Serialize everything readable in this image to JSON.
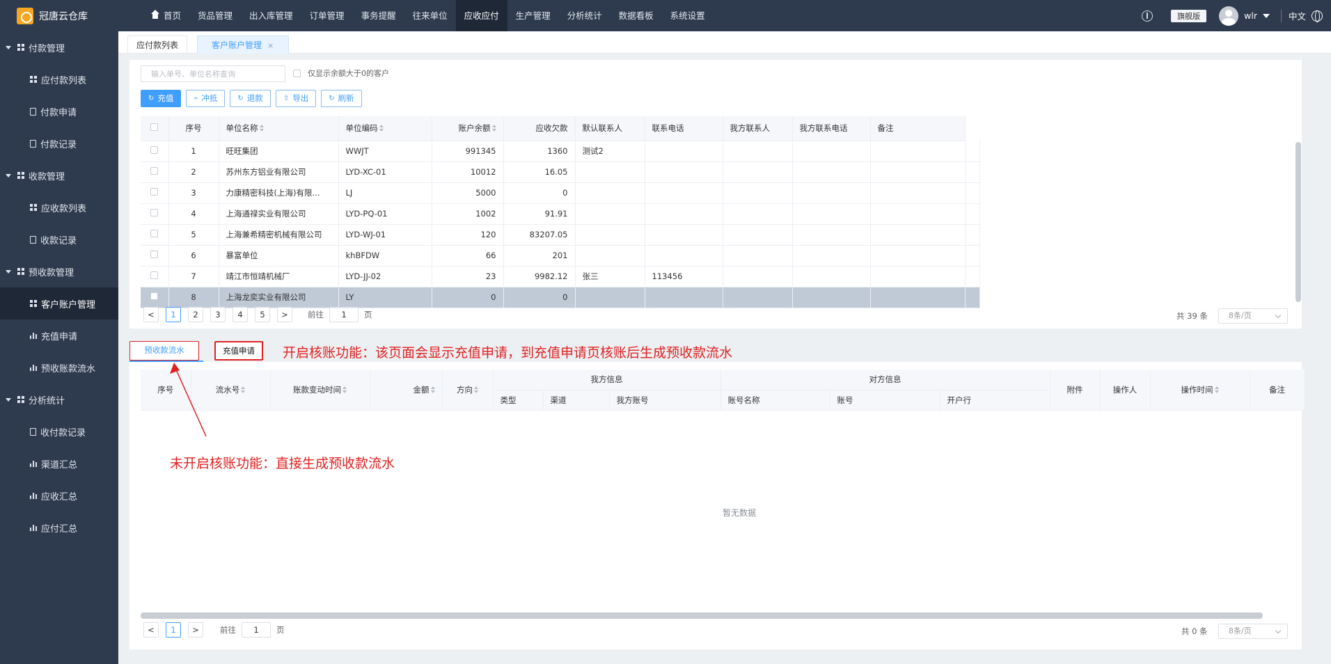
{
  "app": {
    "title": "冠唐云仓库"
  },
  "nav": [
    {
      "label": "首页",
      "icon": "home-icon"
    },
    {
      "label": "货品管理"
    },
    {
      "label": "出入库管理"
    },
    {
      "label": "订单管理"
    },
    {
      "label": "事务提醒"
    },
    {
      "label": "往来单位"
    },
    {
      "label": "应收应付",
      "active": true
    },
    {
      "label": "生产管理"
    },
    {
      "label": "分析统计"
    },
    {
      "label": "数据看板"
    },
    {
      "label": "系统设置"
    }
  ],
  "header": {
    "edition": "旗舰版",
    "user": "wlr",
    "language": "中文"
  },
  "sidebar": {
    "groups": [
      {
        "label": "付款管理",
        "items": [
          {
            "label": "应付款列表",
            "icon": "grid-icon"
          },
          {
            "label": "付款申请",
            "icon": "doc-icon"
          },
          {
            "label": "付款记录",
            "icon": "doc-icon"
          }
        ]
      },
      {
        "label": "收款管理",
        "items": [
          {
            "label": "应收款列表",
            "icon": "grid-icon"
          },
          {
            "label": "收款记录",
            "icon": "doc-icon"
          }
        ]
      },
      {
        "label": "预收款管理",
        "items": [
          {
            "label": "客户账户管理",
            "icon": "grid-icon",
            "active": true
          },
          {
            "label": "充值申请",
            "icon": "bar-chart-icon"
          },
          {
            "label": "预收账款流水",
            "icon": "bar-chart-icon"
          }
        ]
      },
      {
        "label": "分析统计",
        "items": [
          {
            "label": "收付款记录",
            "icon": "doc-icon"
          },
          {
            "label": "渠道汇总",
            "icon": "bar-chart-icon"
          },
          {
            "label": "应收汇总",
            "icon": "bar-chart-icon"
          },
          {
            "label": "应付汇总",
            "icon": "bar-chart-icon"
          }
        ]
      }
    ]
  },
  "tabs": [
    {
      "label": "应付款列表"
    },
    {
      "label": "客户账户管理",
      "active": true,
      "close": "×"
    }
  ],
  "search": {
    "placeholder": "输入单号、单位名称查询",
    "only_positive_label": "仅显示余额大于0的客户"
  },
  "toolbar": [
    {
      "label": "充值",
      "icon": "refresh-icon",
      "glyph": "↻",
      "primary": true
    },
    {
      "label": "冲抵",
      "icon": "offset-icon",
      "glyph": "⌁"
    },
    {
      "label": "退款",
      "icon": "undo-icon",
      "glyph": "↻"
    },
    {
      "label": "导出",
      "icon": "upload-icon",
      "glyph": "⇧"
    },
    {
      "label": "刷新",
      "icon": "refresh-icon",
      "glyph": "↻"
    }
  ],
  "accounts": {
    "columns": [
      "序号",
      "单位名称",
      "单位编码",
      "账户余额",
      "应收欠款",
      "默认联系人",
      "联系电话",
      "我方联系人",
      "我方联系电话",
      "备注"
    ],
    "rows": [
      [
        "1",
        "旺旺集团",
        "WWJT",
        "991345",
        "1360",
        "测试2",
        "",
        "",
        "",
        ""
      ],
      [
        "2",
        "苏州东方铝业有限公司",
        "LYD-XC-01",
        "10012",
        "16.05",
        "",
        "",
        "",
        "",
        ""
      ],
      [
        "3",
        "力康精密科技(上海)有限...",
        "LJ",
        "5000",
        "0",
        "",
        "",
        "",
        "",
        ""
      ],
      [
        "4",
        "上海通禄实业有限公司",
        "LYD-PQ-01",
        "1002",
        "91.91",
        "",
        "",
        "",
        "",
        ""
      ],
      [
        "5",
        "上海兼希精密机械有限公司",
        "LYD-WJ-01",
        "120",
        "83207.05",
        "",
        "",
        "",
        "",
        ""
      ],
      [
        "6",
        "暴富单位",
        "khBFDW",
        "66",
        "201",
        "",
        "",
        "",
        "",
        ""
      ],
      [
        "7",
        "靖江市恒靖机械厂",
        "LYD-JJ-02",
        "23",
        "9982.12",
        "张三",
        "113456",
        "",
        "",
        ""
      ],
      [
        "8",
        "上海龙奕实业有限公司",
        "LY",
        "0",
        "0",
        "",
        "",
        "",
        "",
        ""
      ]
    ],
    "selected_row": 7,
    "pagination": {
      "prev": "<",
      "next": ">",
      "pages": [
        "1",
        "2",
        "3",
        "4",
        "5"
      ],
      "current": "1",
      "goto_prefix": "前往",
      "goto_value": "1",
      "goto_suffix": "页",
      "total": "共 39 条",
      "page_size": "8条/页"
    }
  },
  "subtabs": [
    {
      "label": "预收款流水",
      "active": true
    },
    {
      "label": "充值申请"
    }
  ],
  "annotations": {
    "top": "开启核账功能：该页面会显示充值申请，到充值申请页核账后生成预收款流水",
    "bottom": "未开启核账功能：直接生成预收款流水"
  },
  "flow": {
    "columns": {
      "seq": "序号",
      "flow_no": "流水号",
      "change_time": "账款变动时间",
      "amount": "金额",
      "direction": "方向",
      "our_info": "我方信息",
      "other_info": "对方信息",
      "attachment": "附件",
      "operator": "操作人",
      "op_time": "操作时间",
      "remark": "备注",
      "our_sub": [
        "类型",
        "渠道",
        "我方账号"
      ],
      "other_sub": [
        "账号名称",
        "账号",
        "开户行"
      ]
    },
    "empty_text": "暂无数据",
    "pagination": {
      "prev": "<",
      "next": ">",
      "current": "1",
      "goto_prefix": "前往",
      "goto_value": "1",
      "goto_suffix": "页",
      "total": "共 0 条",
      "page_size": "8条/页"
    }
  },
  "colors": {
    "accent": "#409eff",
    "sidebar_bg": "#2e3a4d",
    "annotation": "#e02020"
  }
}
